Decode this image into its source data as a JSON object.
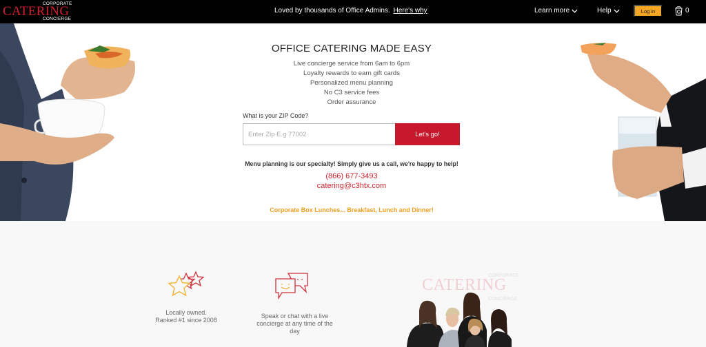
{
  "topbar": {
    "logo": {
      "top": "CORPORATE",
      "main": "CATERING",
      "bottom": "CONCIERGE"
    },
    "tagline": "Loved by thousands of Office Admins.",
    "tagline_link": "Here's why",
    "nav": [
      {
        "label": "Learn more",
        "icon": "chevron-down-icon"
      },
      {
        "label": "Help",
        "icon": "chevron-down-icon"
      }
    ],
    "login_label": "Log in",
    "cart_icon": "cart-icon",
    "cart_count": "0"
  },
  "hero": {
    "headline": "OFFICE CATERING MADE EASY",
    "features": [
      "Live concierge service from 6am to 6pm",
      "Loyalty rewards to earn gift cards",
      "Personalized menu planning",
      "No C3 service fees",
      "Order assurance"
    ],
    "zip_label": "What is your ZIP Code?",
    "zip_placeholder": "Enter Zip E.g 77002",
    "zip_value": "",
    "go_label": "Let's go!",
    "menu_note": "Menu planning is our specialty! Simply give us a call, we're happy to help!",
    "phone": "(866) 677-3493",
    "email": "catering@c3htx.com",
    "box_lunch": "Corporate Box Lunches... Breakfast, Lunch and Dinner!"
  },
  "benefits": [
    {
      "icon": "stars-icon",
      "line1": "Locally owned.",
      "line2": "Ranked #1 since 2008"
    },
    {
      "icon": "chat-icon",
      "line1": "Speak or chat with a live",
      "line2": "concierge at any time of the",
      "line3": "day"
    }
  ],
  "team_watermark": {
    "top": "CORPORATE",
    "main": "CATERING",
    "bottom": "CONCIERGE"
  },
  "colors": {
    "brand_red": "#c8192c",
    "accent_orange": "#f5a623",
    "topbar": "#000000"
  }
}
